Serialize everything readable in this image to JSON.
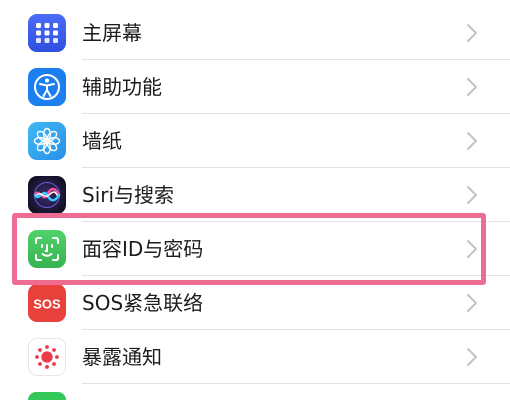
{
  "rows": [
    {
      "id": "home-screen",
      "label": "主屏幕",
      "icon": "home-screen-icon",
      "color": "#3a5df0"
    },
    {
      "id": "accessibility",
      "label": "辅助功能",
      "icon": "accessibility-icon",
      "color": "#1b7ff0"
    },
    {
      "id": "wallpaper",
      "label": "墙纸",
      "icon": "wallpaper-icon",
      "color": "#37aaf0"
    },
    {
      "id": "siri",
      "label": "Siri与搜索",
      "icon": "siri-icon",
      "color": "#1a1a2e"
    },
    {
      "id": "face-id",
      "label": "面容ID与密码",
      "icon": "face-id-icon",
      "color": "#43c35e"
    },
    {
      "id": "sos",
      "label": "SOS紧急联络",
      "icon": "sos-icon",
      "color": "#e8413c",
      "icon_text": "SOS"
    },
    {
      "id": "exposure",
      "label": "暴露通知",
      "icon": "exposure-icon",
      "color": "#ffffff"
    }
  ],
  "highlight": {
    "color": "#ee6b92",
    "target": "face-id"
  }
}
